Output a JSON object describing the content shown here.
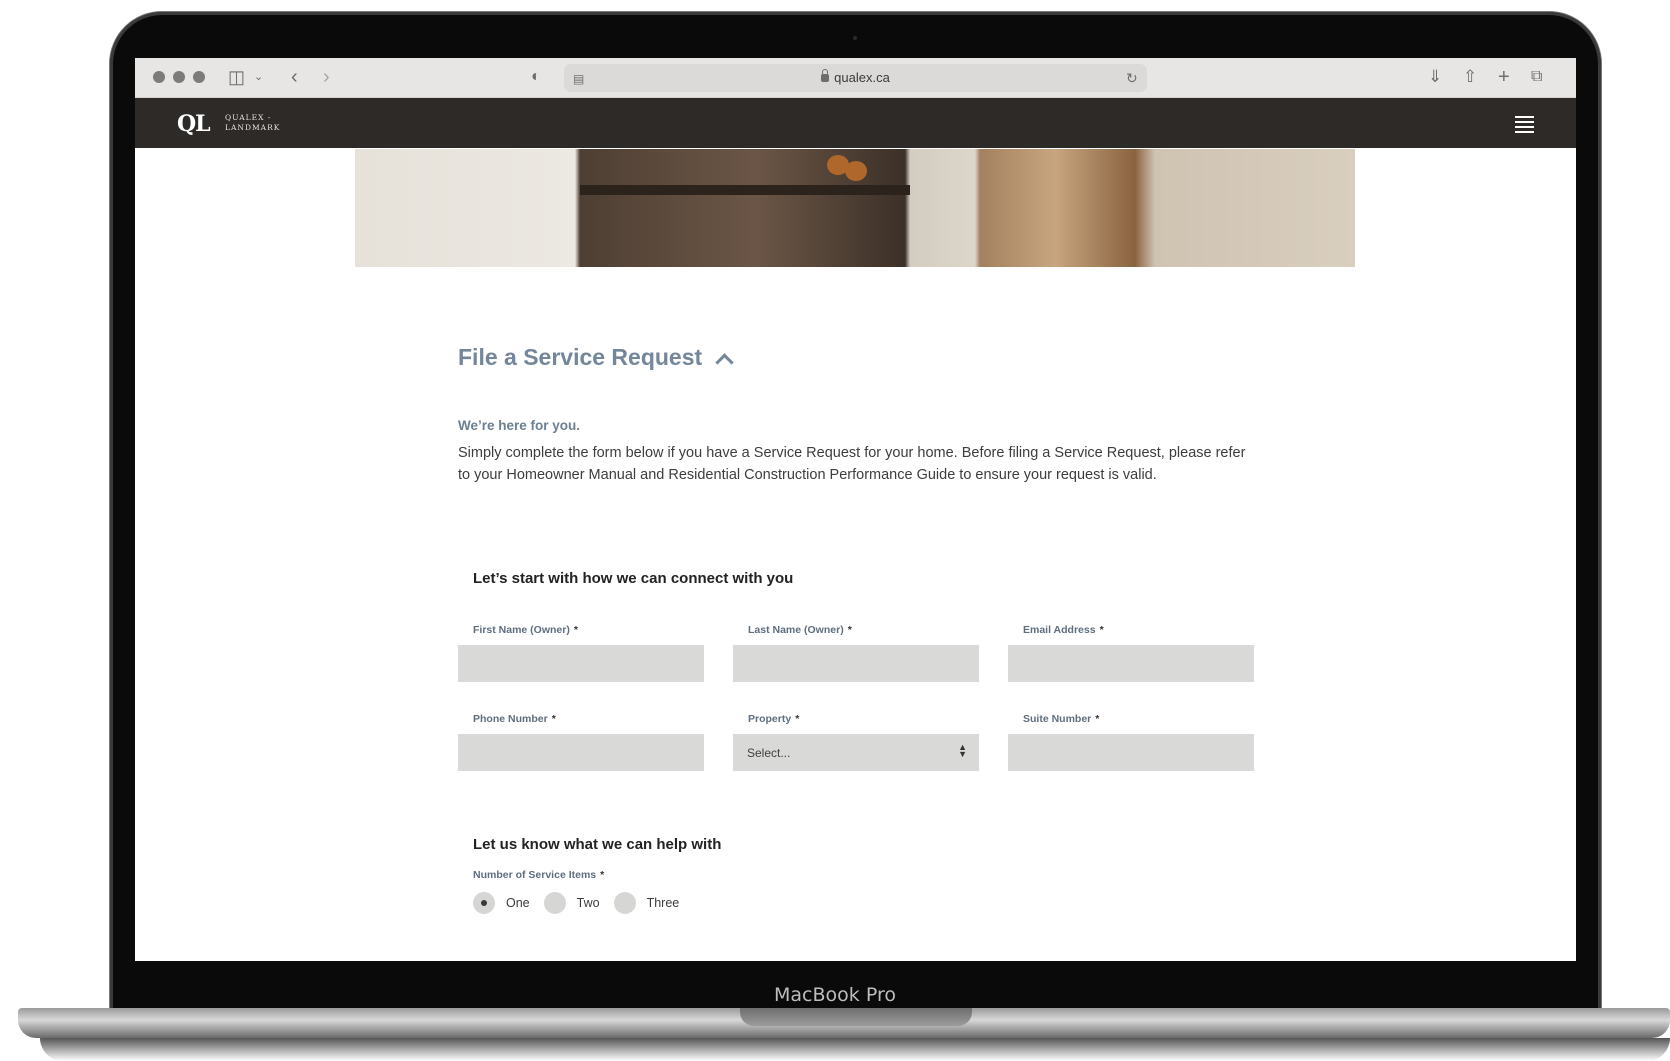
{
  "browser": {
    "url": "qualex.ca"
  },
  "device": {
    "label": "MacBook Pro"
  },
  "site": {
    "logo_mark": "QL",
    "logo_line1": "QUALEX -",
    "logo_line2": "LANDMARK"
  },
  "page": {
    "section_title": "File a Service Request",
    "tagline": "We’re here for you.",
    "intro": "Simply complete the form below if you have a Service Request for your home. Before filing a Service Request, please refer to your Homeowner Manual and Residential Construction Performance Guide to ensure your request is valid."
  },
  "form": {
    "contact_heading": "Let’s start with how we can connect with you",
    "required_mark": "*",
    "fields": {
      "first_name": {
        "label": "First Name (Owner)",
        "value": ""
      },
      "last_name": {
        "label": "Last Name (Owner)",
        "value": ""
      },
      "email": {
        "label": "Email Address",
        "value": ""
      },
      "phone": {
        "label": "Phone Number",
        "value": ""
      },
      "property": {
        "label": "Property",
        "selected": "Select..."
      },
      "suite": {
        "label": "Suite Number",
        "value": ""
      }
    },
    "help_heading": "Let us know what we can help with",
    "service_items": {
      "label": "Number of Service Items",
      "options": [
        "One",
        "Two",
        "Three"
      ],
      "selected": "One"
    }
  },
  "colors": {
    "header_bg": "#2d2a28",
    "title_color": "#73869a",
    "input_bg": "#d9d9d8"
  }
}
